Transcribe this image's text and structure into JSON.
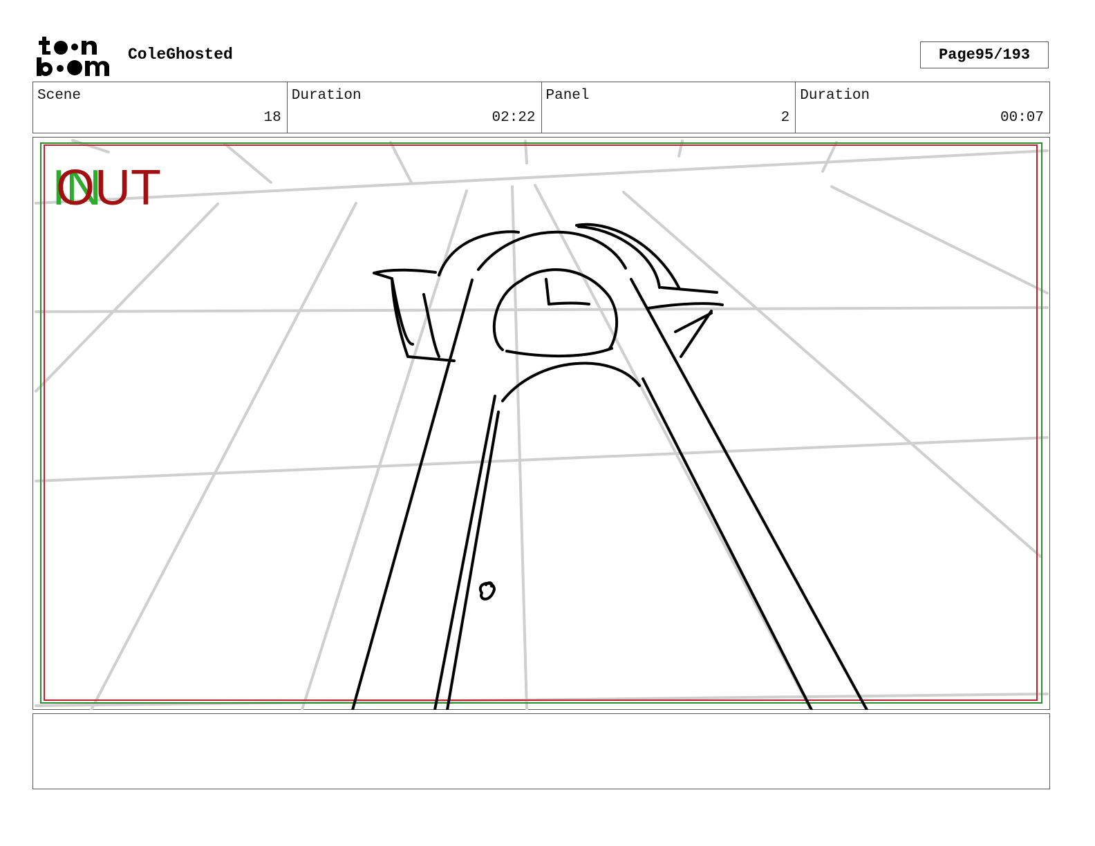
{
  "header": {
    "logo_text": "toonboom",
    "project_title": "ColeGhosted",
    "page_label": "Page",
    "page_value": "95/193"
  },
  "info": {
    "scene_label": "Scene",
    "scene_value": "18",
    "scene_duration_label": "Duration",
    "scene_duration_value": "02:22",
    "panel_label": "Panel",
    "panel_value": "2",
    "panel_duration_label": "Duration",
    "panel_duration_value": "00:07"
  },
  "panel": {
    "in_marker": "IN",
    "out_marker": "OUT",
    "colors": {
      "in_marker": "#2eaa2e",
      "out_marker": "#a01010",
      "safe_frame_green": "#2e8b2e",
      "safe_frame_red": "#c0202a",
      "guide_lines": "#cfcfcf",
      "sketch": "#000000"
    }
  },
  "notes": {
    "text": ""
  }
}
